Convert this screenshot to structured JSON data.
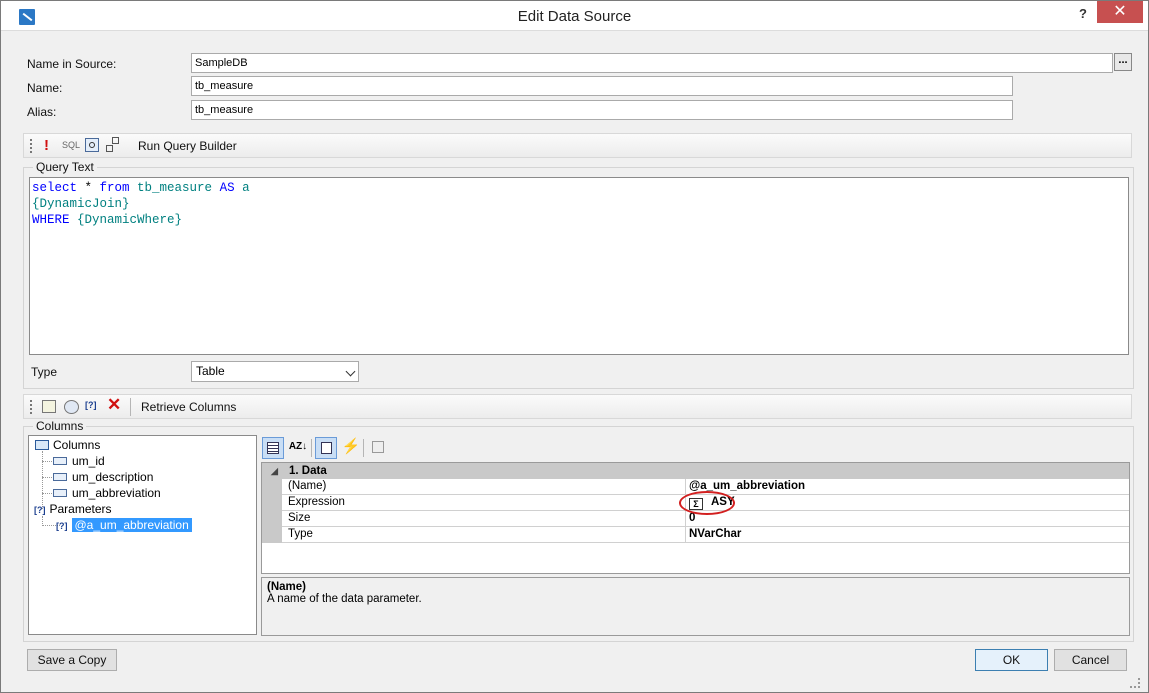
{
  "window": {
    "title": "Edit Data Source",
    "help": "?",
    "close": "✕"
  },
  "form": {
    "name_in_source_label": "Name in Source:",
    "name_in_source_value": "SampleDB",
    "browse_label": "...",
    "name_label": "Name:",
    "name_value": "tb_measure",
    "alias_label": "Alias:",
    "alias_value": "tb_measure"
  },
  "query_toolbar": {
    "sql_label": "SQL",
    "run_query_builder": "Run Query Builder"
  },
  "query": {
    "group_title": "Query Text",
    "line1": {
      "kw1": "select",
      "star": " * ",
      "kw2": "from",
      "tx": " tb_measure ",
      "kw3": "AS",
      "tx2": " a"
    },
    "line2": "{DynamicJoin}",
    "line3": {
      "kw": "WHERE",
      "tx": " {DynamicWhere}"
    }
  },
  "type": {
    "label": "Type",
    "value": "Table"
  },
  "columns_toolbar": {
    "retrieve_columns": "Retrieve Columns"
  },
  "columns_group": {
    "title": "Columns"
  },
  "tree": {
    "columns_node": "Columns",
    "columns": [
      "um_id",
      "um_description",
      "um_abbreviation"
    ],
    "parameters_node": "Parameters",
    "param_icon": "[?]",
    "parameters": [
      "@a_um_abbreviation"
    ]
  },
  "property_grid": {
    "category": "1. Data",
    "rows": [
      {
        "name": "(Name)",
        "value": "@a_um_abbreviation"
      },
      {
        "name": "Expression",
        "value": "ASY",
        "expr_icon": "Σ"
      },
      {
        "name": "Size",
        "value": "0"
      },
      {
        "name": "Type",
        "value": "NVarChar"
      }
    ]
  },
  "description": {
    "title": "(Name)",
    "text": "A name of the data parameter."
  },
  "buttons": {
    "save_copy": "Save a Copy",
    "ok": "OK",
    "cancel": "Cancel"
  },
  "colors": {
    "accent": "#3399ff",
    "close": "#c75050",
    "annotation": "#d21f1f",
    "sql_keyword": "#0000ff",
    "sql_text": "#008080"
  }
}
